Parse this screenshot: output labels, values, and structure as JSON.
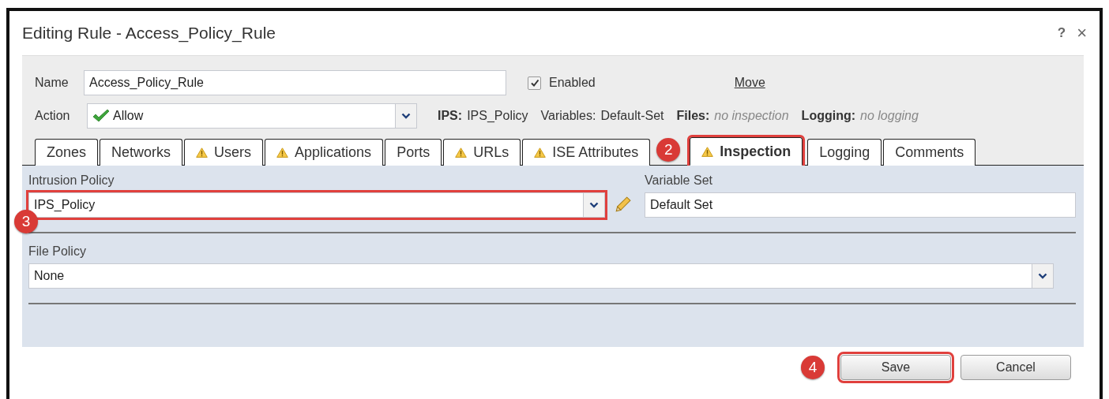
{
  "window": {
    "title": "Editing Rule - Access_Policy_Rule",
    "help": "?",
    "close": "×"
  },
  "name": {
    "label": "Name",
    "value": "Access_Policy_Rule"
  },
  "enabled": {
    "label": "Enabled",
    "checked": true
  },
  "move_link": "Move",
  "action": {
    "label": "Action",
    "value": "Allow"
  },
  "summary": [
    {
      "label": "IPS:",
      "value": "IPS_Policy",
      "kind": "plain"
    },
    {
      "label": "Variables:",
      "value": "Default-Set",
      "kind": "unbold"
    },
    {
      "label": "Files:",
      "value": "no inspection",
      "kind": "italic"
    },
    {
      "label": "Logging:",
      "value": "no logging",
      "kind": "italic"
    }
  ],
  "tabs": [
    {
      "label": "Zones",
      "warning": false,
      "selected": false,
      "highlighted": false
    },
    {
      "label": "Networks",
      "warning": false,
      "selected": false,
      "highlighted": false
    },
    {
      "label": "Users",
      "warning": true,
      "selected": false,
      "highlighted": false
    },
    {
      "label": "Applications",
      "warning": true,
      "selected": false,
      "highlighted": false
    },
    {
      "label": "Ports",
      "warning": false,
      "selected": false,
      "highlighted": false
    },
    {
      "label": "URLs",
      "warning": true,
      "selected": false,
      "highlighted": false
    },
    {
      "label": "ISE Attributes",
      "warning": true,
      "selected": false,
      "highlighted": false
    },
    {
      "label": "Inspection",
      "warning": true,
      "selected": true,
      "highlighted": true,
      "callout": "2"
    },
    {
      "label": "Logging",
      "warning": false,
      "selected": false,
      "highlighted": false
    },
    {
      "label": "Comments",
      "warning": false,
      "selected": false,
      "highlighted": false
    }
  ],
  "intrusion_policy": {
    "label": "Intrusion Policy",
    "value": "IPS_Policy",
    "highlighted": true,
    "callout": "3"
  },
  "variable_set": {
    "label": "Variable Set",
    "value": "Default Set"
  },
  "file_policy": {
    "label": "File Policy",
    "value": "None"
  },
  "buttons": [
    {
      "label": "Save",
      "highlighted": true,
      "callout": "4"
    },
    {
      "label": "Cancel",
      "highlighted": false
    }
  ]
}
